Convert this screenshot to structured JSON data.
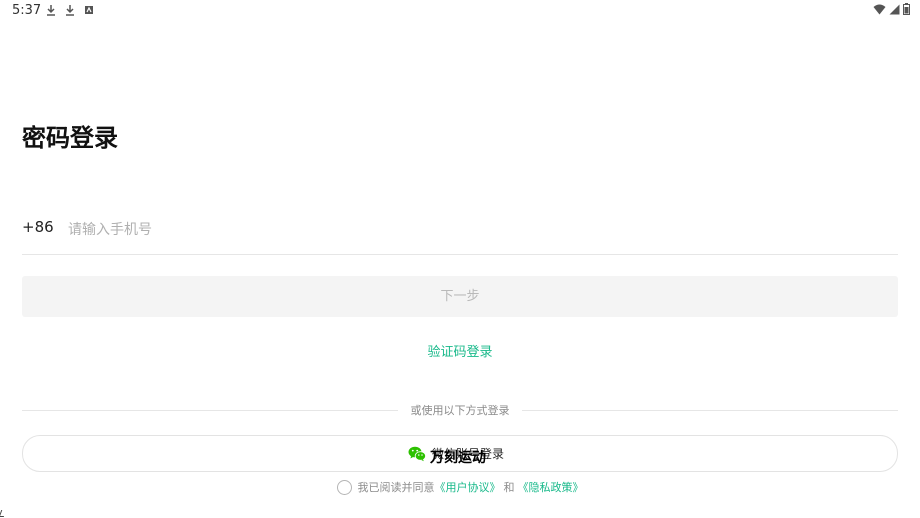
{
  "status_bar": {
    "time": "5:37",
    "left_icons": [
      "download-icon",
      "download-icon",
      "notification-icon"
    ],
    "right_icons": [
      "wifi-icon",
      "signal-icon",
      "battery-icon"
    ]
  },
  "login": {
    "title": "密码登录",
    "country_code": "+86",
    "phone_placeholder": "请输入手机号",
    "phone_value": "",
    "next_label": "下一步",
    "sms_login_label": "验证码登录",
    "divider_text": "或使用以下方式登录",
    "wechat_label": "微信账号登录",
    "overlay_app_name": "万刻运动"
  },
  "agreement": {
    "prefix": "我已阅读并同意",
    "user_agreement": "《用户协议》",
    "and": "和",
    "privacy_policy": "《隐私政策》",
    "checked": false
  },
  "colors": {
    "accent": "#18b98a",
    "wechat_green": "#2dc100",
    "button_disabled_bg": "#f4f4f4",
    "button_disabled_text": "#b9b9b9"
  }
}
